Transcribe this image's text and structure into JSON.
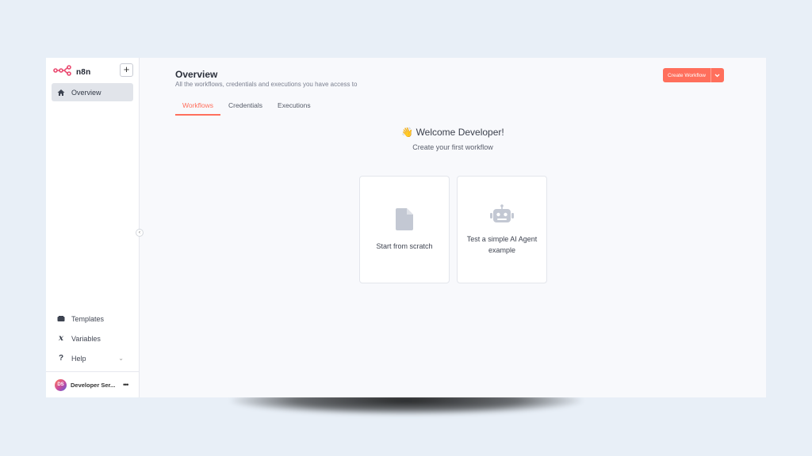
{
  "app": {
    "brand": "n8n",
    "add_label": "+",
    "collapse_label": "‹"
  },
  "sidebar": {
    "items": [
      {
        "label": "Overview",
        "icon": "home-icon",
        "active": true
      }
    ],
    "bottom_items": [
      {
        "label": "Templates",
        "icon": "templates-icon"
      },
      {
        "label": "Variables",
        "icon": "variables-icon"
      },
      {
        "label": "Help",
        "icon": "help-icon"
      }
    ],
    "user": {
      "initials": "DS",
      "name": "Developer Ser...",
      "more": "•••"
    }
  },
  "header": {
    "title": "Overview",
    "subtitle": "All the workflows, credentials and executions you have access to",
    "create_label": "Create Workflow"
  },
  "tabs": [
    {
      "label": "Workflows",
      "active": true
    },
    {
      "label": "Credentials",
      "active": false
    },
    {
      "label": "Executions",
      "active": false
    }
  ],
  "empty_state": {
    "welcome_emoji": "👋",
    "welcome": "Welcome Developer!",
    "subtitle": "Create your first workflow",
    "cards": [
      {
        "label": "Start from scratch",
        "icon": "file-icon"
      },
      {
        "label": "Test a simple AI Agent example",
        "icon": "robot-icon"
      }
    ]
  },
  "colors": {
    "accent": "#ff6f5c",
    "brand": "#ea4b71",
    "icon_gray": "#c3c8d3"
  }
}
